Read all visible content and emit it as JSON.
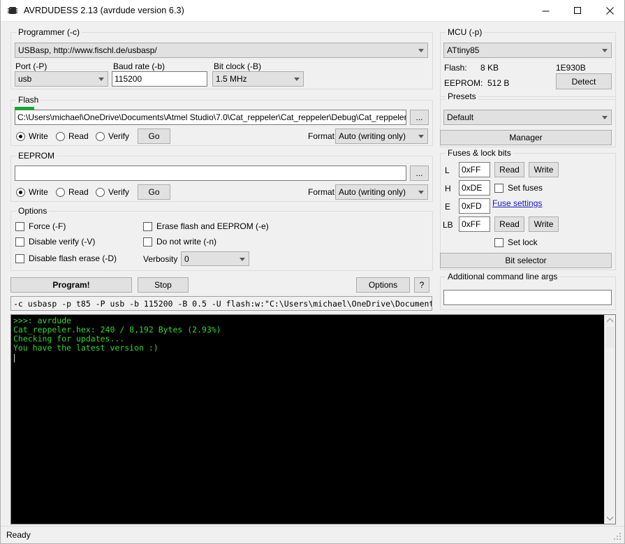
{
  "window": {
    "title": "AVRDUDESS 2.13 (avrdude version 6.3)",
    "icon": "chip-icon",
    "minimize": "minimize-icon",
    "maximize": "maximize-icon",
    "close": "close-icon"
  },
  "programmer": {
    "group_label": "Programmer (-c)",
    "selected": "USBasp, http://www.fischl.de/usbasp/",
    "port_label": "Port (-P)",
    "port_value": "usb",
    "baud_label": "Baud rate (-b)",
    "baud_value": "115200",
    "bitclock_label": "Bit clock (-B)",
    "bitclock_value": "1.5 MHz"
  },
  "flash": {
    "group_label": "Flash",
    "path": "C:\\Users\\michael\\OneDrive\\Documents\\Atmel Studio\\7.0\\Cat_reppeler\\Cat_reppeler\\Debug\\Cat_reppeler.hex",
    "browse_label": "...",
    "write_label": "Write",
    "read_label": "Read",
    "verify_label": "Verify",
    "selected_action": "Write",
    "go_label": "Go",
    "format_label": "Format",
    "format_value": "Auto (writing only)"
  },
  "eeprom": {
    "group_label": "EEPROM",
    "path": "",
    "browse_label": "...",
    "write_label": "Write",
    "read_label": "Read",
    "verify_label": "Verify",
    "selected_action": "Write",
    "go_label": "Go",
    "format_label": "Format",
    "format_value": "Auto (writing only)"
  },
  "options": {
    "group_label": "Options",
    "force": {
      "label": "Force (-F)",
      "checked": false
    },
    "disable_verify": {
      "label": "Disable verify (-V)",
      "checked": false
    },
    "disable_flash_erase": {
      "label": "Disable flash erase (-D)",
      "checked": false
    },
    "erase_flash_eeprom": {
      "label": "Erase flash and EEPROM (-e)",
      "checked": false
    },
    "do_not_write": {
      "label": "Do not write (-n)",
      "checked": false
    },
    "verbosity_label": "Verbosity",
    "verbosity_value": "0"
  },
  "actions": {
    "program_label": "Program!",
    "stop_label": "Stop",
    "options_label": "Options",
    "help_label": "?"
  },
  "commandline": {
    "value": "-c usbasp -p t85 -P usb -b 115200 -B 0.5 -U flash:w:\"C:\\Users\\michael\\OneDrive\\Documents\\Atmel Studi"
  },
  "mcu": {
    "group_label": "MCU (-p)",
    "selected": "ATtiny85",
    "flash_label": "Flash:",
    "flash_value": "8 KB",
    "signature": "1E930B",
    "eeprom_label": "EEPROM:",
    "eeprom_value": "512 B",
    "detect_label": "Detect"
  },
  "presets": {
    "group_label": "Presets",
    "selected": "Default",
    "manager_label": "Manager"
  },
  "fuses": {
    "group_label": "Fuses & lock bits",
    "l_label": "L",
    "l_value": "0xFF",
    "h_label": "H",
    "h_value": "0xDE",
    "e_label": "E",
    "e_value": "0xFD",
    "lb_label": "LB",
    "lb_value": "0xFF",
    "read_fuses_label": "Read",
    "write_fuses_label": "Write",
    "set_fuses": {
      "label": "Set fuses",
      "checked": false
    },
    "fuse_settings_link": "Fuse settings",
    "read_lock_label": "Read",
    "write_lock_label": "Write",
    "set_lock": {
      "label": "Set lock",
      "checked": false
    },
    "bit_selector_label": "Bit selector"
  },
  "extra_args": {
    "group_label": "Additional command line args",
    "value": ""
  },
  "console": {
    "lines": [
      ">>>: avrdude",
      "Cat_reppeler.hex: 240 / 8,192 Bytes (2.93%)",
      "Checking for updates...",
      "You have the latest version :)"
    ],
    "scroll_up_icon": "chevron-up-icon",
    "scroll_down_icon": "chevron-down-icon"
  },
  "statusbar": {
    "text": "Ready"
  },
  "colors": {
    "accent_link": "#1818c8",
    "console_text": "#33d633",
    "console_bg": "#000000",
    "window_bg": "#f0f0f0",
    "progress": "#06b025"
  }
}
